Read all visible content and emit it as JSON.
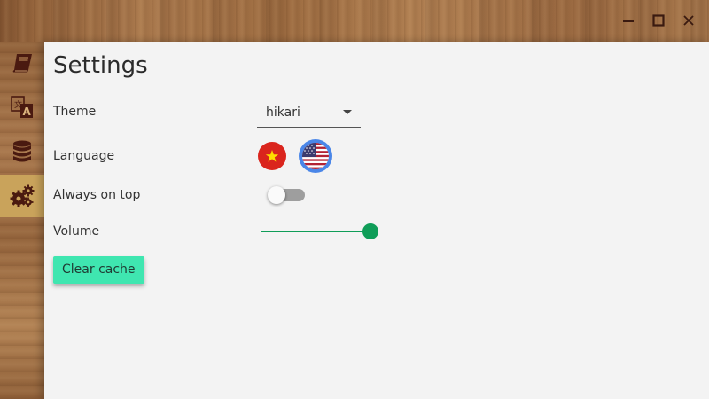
{
  "window": {
    "controls": [
      {
        "name": "minimize",
        "icon": "minimize-icon"
      },
      {
        "name": "maximize",
        "icon": "maximize-icon"
      },
      {
        "name": "close",
        "icon": "close-icon"
      }
    ]
  },
  "sidebar": {
    "items": [
      {
        "icon": "book-icon",
        "active": false
      },
      {
        "icon": "translate-icon",
        "active": false
      },
      {
        "icon": "database-icon",
        "active": false
      },
      {
        "icon": "gears-icon",
        "active": true
      }
    ],
    "active_color": "#c9a35b",
    "icon_color": "#4a1a10"
  },
  "settings": {
    "title": "Settings",
    "theme": {
      "label": "Theme",
      "value": "hikari"
    },
    "language": {
      "label": "Language",
      "options": [
        {
          "icon": "vietnam-flag-icon",
          "selected": false
        },
        {
          "icon": "us-flag-icon",
          "selected": true
        }
      ]
    },
    "always_on_top": {
      "label": "Always on top",
      "value": false
    },
    "volume": {
      "label": "Volume",
      "value": 1.0
    },
    "clear_cache": {
      "label": "Clear cache"
    }
  },
  "colors": {
    "accent": "#0f9d58",
    "button": "#3fe6b0",
    "panel": "#f3f3f3"
  }
}
